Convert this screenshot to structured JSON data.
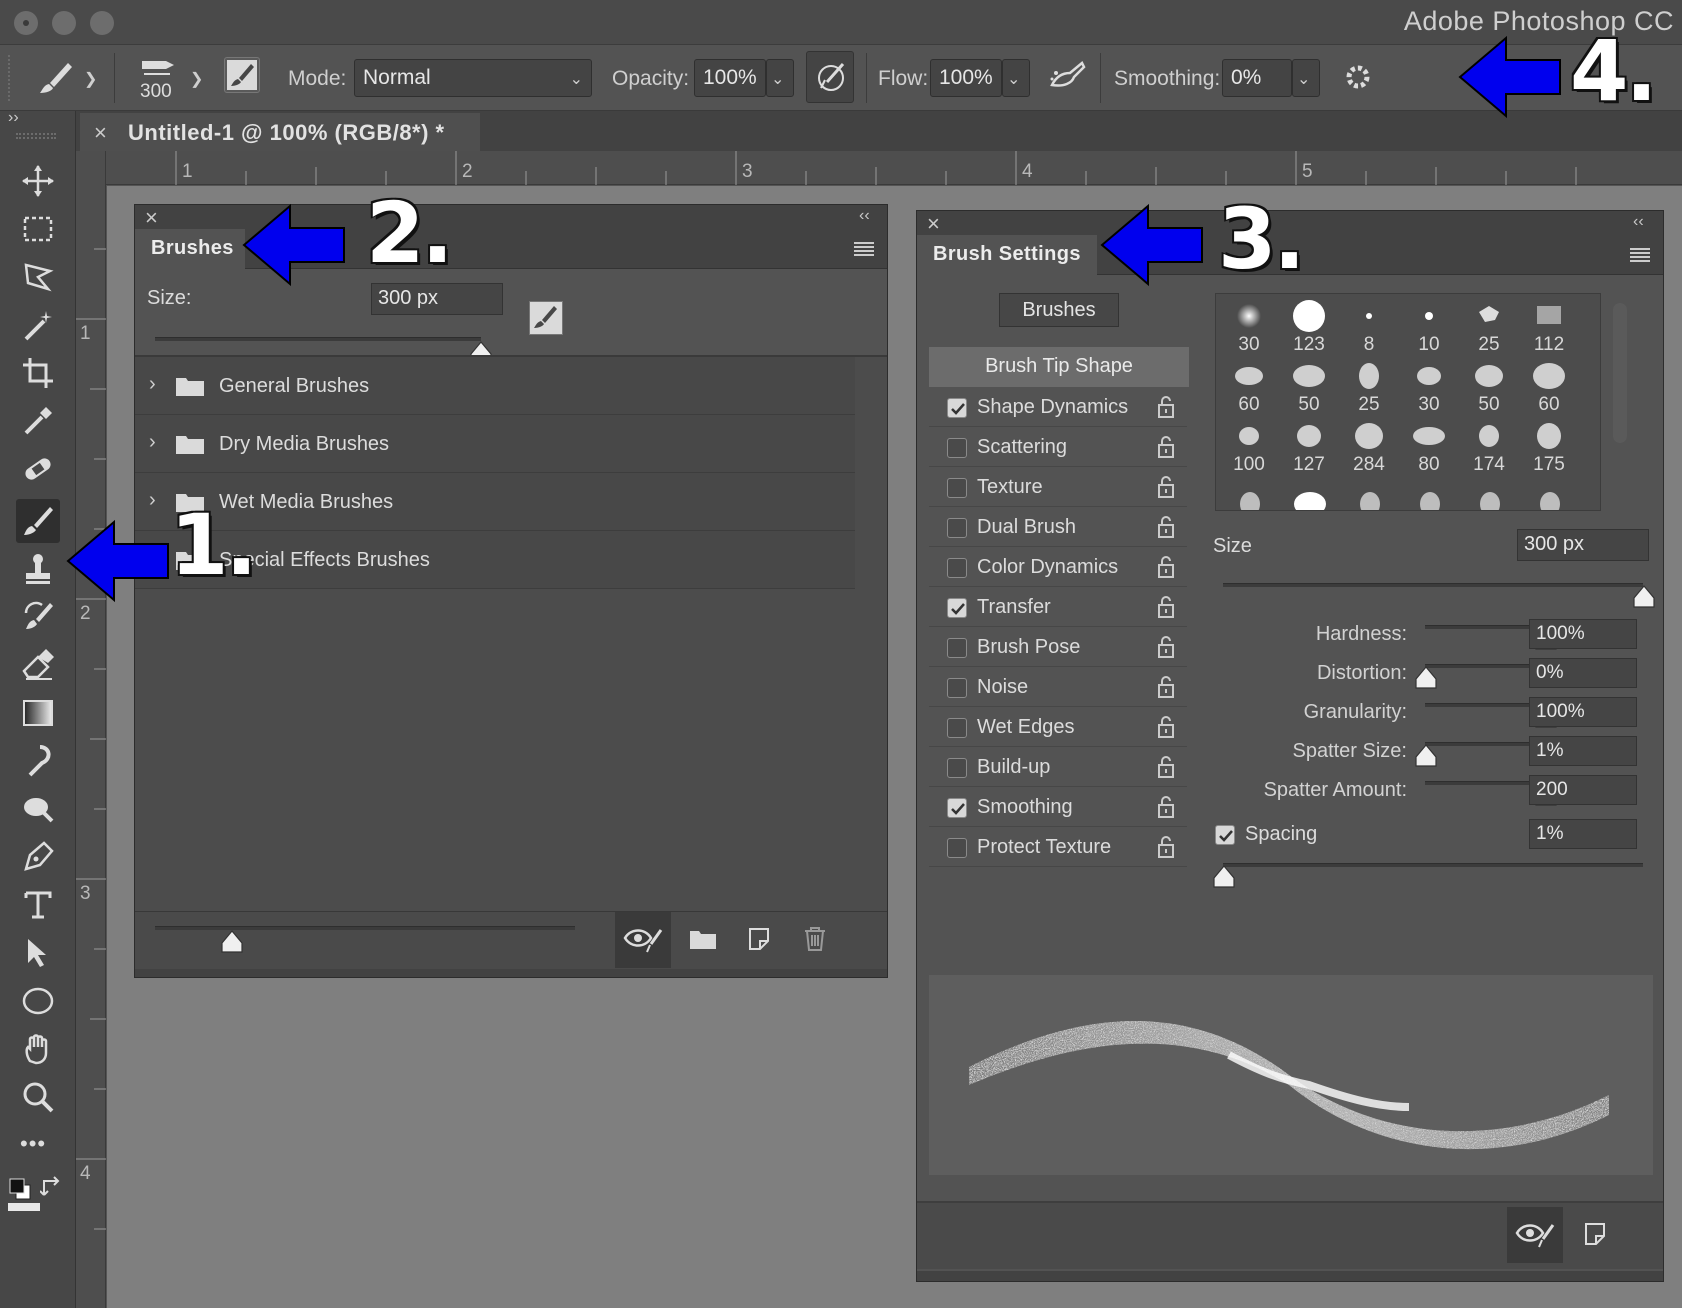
{
  "app_title": "Adobe Photoshop CC",
  "options_bar": {
    "brush_size": "300",
    "mode_label": "Mode:",
    "mode_value": "Normal",
    "opacity_label": "Opacity:",
    "opacity_value": "100%",
    "flow_label": "Flow:",
    "flow_value": "100%",
    "smoothing_label": "Smoothing:",
    "smoothing_value": "0%"
  },
  "document_tab": {
    "close": "×",
    "title": "Untitled-1 @ 100% (RGB/8*) *"
  },
  "rulers": {
    "top": [
      "1",
      "2",
      "3",
      "4",
      "5"
    ],
    "left": [
      "1",
      "2",
      "3",
      "4"
    ]
  },
  "toolbar": {
    "expand": "››",
    "more": "•••"
  },
  "brushes_panel": {
    "title": "Brushes",
    "close": "×",
    "collapse": "‹‹",
    "size_label": "Size:",
    "size_value": "300 px",
    "size_slider_fraction": 1.0,
    "folders": [
      "General Brushes",
      "Dry Media Brushes",
      "Wet Media Brushes",
      "Special Effects Brushes"
    ]
  },
  "brush_settings_panel": {
    "title": "Brush Settings",
    "close": "×",
    "collapse": "‹‹",
    "brushes_button": "Brushes",
    "tip_shape_header": "Brush Tip Shape",
    "options": [
      {
        "label": "Shape Dynamics",
        "checked": true
      },
      {
        "label": "Scattering",
        "checked": false
      },
      {
        "label": "Texture",
        "checked": false
      },
      {
        "label": "Dual Brush",
        "checked": false
      },
      {
        "label": "Color Dynamics",
        "checked": false
      },
      {
        "label": "Transfer",
        "checked": true
      },
      {
        "label": "Brush Pose",
        "checked": false
      },
      {
        "label": "Noise",
        "checked": false
      },
      {
        "label": "Wet Edges",
        "checked": false
      },
      {
        "label": "Build-up",
        "checked": false
      },
      {
        "label": "Smoothing",
        "checked": true
      },
      {
        "label": "Protect Texture",
        "checked": false
      }
    ],
    "tip_sizes": [
      "30",
      "123",
      "8",
      "10",
      "25",
      "112",
      "60",
      "50",
      "25",
      "30",
      "50",
      "60",
      "100",
      "127",
      "284",
      "80",
      "174",
      "175"
    ],
    "size_label": "Size",
    "size_value": "300 px",
    "params": [
      {
        "label": "Hardness:",
        "value": "100%",
        "fraction": 1.0
      },
      {
        "label": "Distortion:",
        "value": "0%",
        "fraction": 0.0
      },
      {
        "label": "Granularity:",
        "value": "100%",
        "fraction": 1.0
      },
      {
        "label": "Spatter Size:",
        "value": "1%",
        "fraction": 0.0
      },
      {
        "label": "Spatter Amount:",
        "value": "200",
        "fraction": 1.0
      }
    ],
    "spacing_label": "Spacing",
    "spacing_value": "1%",
    "spacing_checked": true
  },
  "annotations": [
    "1.",
    "2.",
    "3.",
    "4."
  ],
  "colors": {
    "arrow": "#0000ee",
    "panel": "#535353",
    "canvas": "#7f7f7f"
  }
}
